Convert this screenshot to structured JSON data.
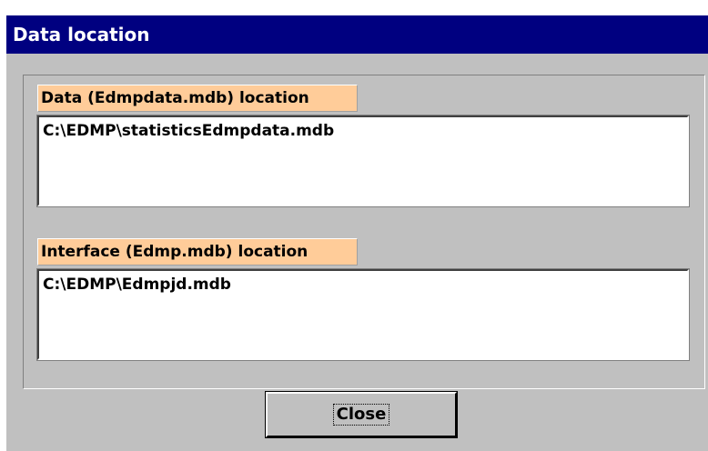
{
  "window": {
    "title": "Data location"
  },
  "data_section": {
    "label": "Data (Edmpdata.mdb) location",
    "value": "C:\\EDMP\\statisticsEdmpdata.mdb"
  },
  "interface_section": {
    "label": "Interface (Edmp.mdb) location",
    "value": "C:\\EDMP\\Edmpjd.mdb"
  },
  "buttons": {
    "close_label": "Close"
  },
  "colors": {
    "titlebar": "#000080",
    "window_background": "#c0c0c0",
    "label_background": "#ffcc99",
    "field_background": "#ffffff"
  }
}
